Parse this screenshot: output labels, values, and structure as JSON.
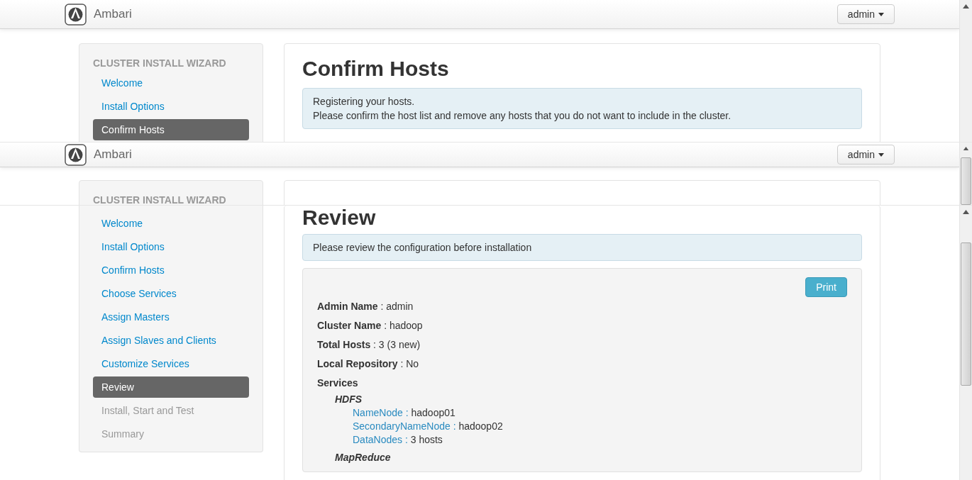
{
  "slices": [
    {
      "header": {
        "brand": "Ambari",
        "user_menu": "admin"
      },
      "sidebar": {
        "title": "CLUSTER INSTALL WIZARD",
        "items": [
          {
            "label": "Welcome",
            "selected": false,
            "disabled": false
          },
          {
            "label": "Install Options",
            "selected": false,
            "disabled": false
          },
          {
            "label": "Confirm Hosts",
            "selected": true,
            "disabled": false
          }
        ]
      },
      "main": {
        "title": "Confirm Hosts",
        "alert": [
          "Registering your hosts.",
          "Please confirm the host list and remove any hosts that you do not want to include in the cluster."
        ]
      }
    },
    {
      "header": {
        "brand": "Ambari",
        "user_menu": "admin"
      },
      "sidebar": {
        "title": "CLUSTER INSTALL WIZARD"
      }
    },
    {
      "sidebar": {
        "items": [
          {
            "label": "Welcome",
            "selected": false,
            "disabled": false
          },
          {
            "label": "Install Options",
            "selected": false,
            "disabled": false
          },
          {
            "label": "Confirm Hosts",
            "selected": false,
            "disabled": false
          },
          {
            "label": "Choose Services",
            "selected": false,
            "disabled": false
          },
          {
            "label": "Assign Masters",
            "selected": false,
            "disabled": false
          },
          {
            "label": "Assign Slaves and Clients",
            "selected": false,
            "disabled": false
          },
          {
            "label": "Customize Services",
            "selected": false,
            "disabled": false
          },
          {
            "label": "Review",
            "selected": true,
            "disabled": false
          },
          {
            "label": "Install, Start and Test",
            "selected": false,
            "disabled": true
          },
          {
            "label": "Summary",
            "selected": false,
            "disabled": true
          }
        ]
      },
      "main": {
        "title": "Review",
        "alert": [
          "Please review the configuration before installation"
        ],
        "summary": {
          "print_button": "Print",
          "fields": [
            {
              "label": "Admin Name",
              "value": " : admin"
            },
            {
              "label": "Cluster Name",
              "value": " : hadoop"
            },
            {
              "label": "Total Hosts",
              "value": " : 3 (3 new)"
            },
            {
              "label": "Local Repository",
              "value": " : No"
            }
          ],
          "services_label": "Services",
          "services": [
            {
              "name": "HDFS",
              "components": [
                {
                  "label": "NameNode :",
                  "value": "hadoop01"
                },
                {
                  "label": "SecondaryNameNode :",
                  "value": "hadoop02"
                },
                {
                  "label": "DataNodes :",
                  "value": "3 hosts"
                }
              ]
            },
            {
              "name": "MapReduce"
            }
          ]
        }
      }
    }
  ]
}
